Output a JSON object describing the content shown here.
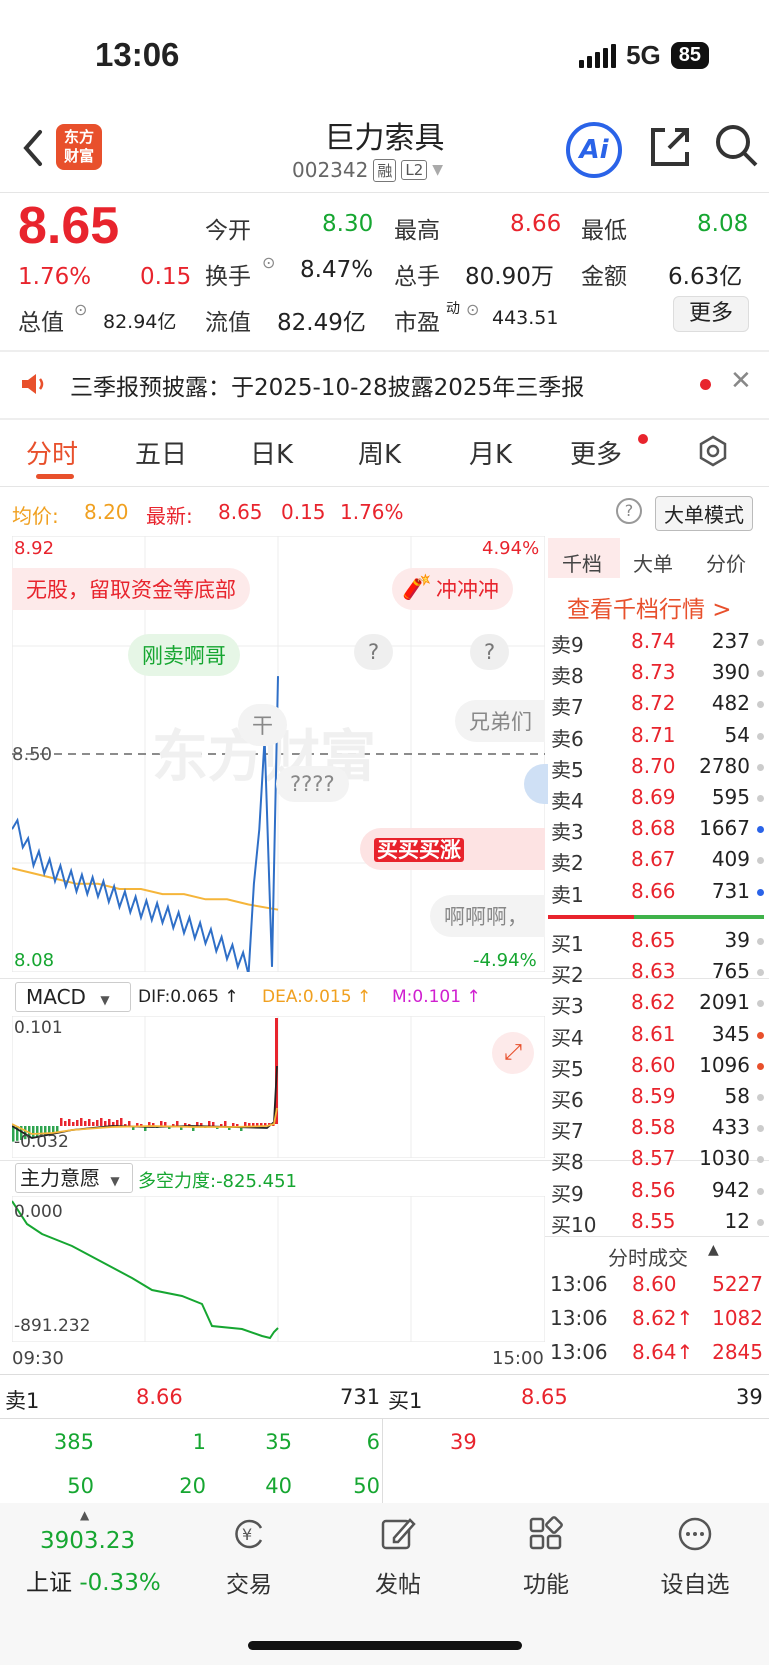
{
  "status": {
    "time": "13:06",
    "network": "5G",
    "battery": "85"
  },
  "header": {
    "logo_line1": "东方",
    "logo_line2": "财富",
    "name": "巨力索具",
    "code": "002342",
    "tag_rong": "融",
    "tag_l2": "L2",
    "ai_label": "Ai"
  },
  "quote": {
    "price": "8.65",
    "change_pct": "1.76%",
    "change": "0.15",
    "open_label": "今开",
    "open": "8.30",
    "high_label": "最高",
    "high": "8.66",
    "low_label": "最低",
    "low": "8.08",
    "turnover_label": "换手",
    "turnover": "8.47%",
    "volume_label": "总手",
    "volume": "80.90万",
    "amount_label": "金额",
    "amount": "6.63亿",
    "mktcap_label": "总值",
    "mktcap": "82.94亿",
    "float_label": "流值",
    "float": "82.49亿",
    "pe_label": "市盈",
    "pe_sup": "动",
    "pe": "443.51",
    "more": "更多"
  },
  "notice": {
    "text": "三季报预披露：于2025-10-28披露2025年三季报"
  },
  "tabs": [
    "分时",
    "五日",
    "日K",
    "周K",
    "月K",
    "更多"
  ],
  "info_row": {
    "avg_label": "均价:",
    "avg": "8.20",
    "latest_label": "最新:",
    "latest": "8.65",
    "chg": "0.15",
    "pct": "1.76%",
    "mode": "大单模式"
  },
  "chart": {
    "y_top": "8.92",
    "pct_top": "4.94%",
    "y_mid": "8.50",
    "y_bot": "8.08",
    "pct_bot": "-4.94%",
    "watermark": "东方财富",
    "bubbles": [
      "无股，留取资金等底部",
      "冲冲冲",
      "刚卖啊哥",
      "?",
      "?",
      "干",
      "兄弟们",
      "????",
      "买买买涨",
      "啊啊啊，"
    ],
    "macd_label": "MACD",
    "dif": "DIF:0.065 ↑",
    "dea": "DEA:0.015 ↑",
    "m": "M:0.101 ↑",
    "macd_top": "0.101",
    "macd_bot": "-0.032",
    "zl_label": "主力意愿",
    "zl_value": "多空力度:-825.451",
    "zl_top": "0.000",
    "zl_bot": "-891.232",
    "t_start": "09:30",
    "t_end": "15:00"
  },
  "chart_data": {
    "type": "line",
    "title": "",
    "ylim": [
      8.08,
      8.92
    ],
    "series": [
      {
        "name": "最新",
        "values": [
          8.37,
          8.3,
          8.27,
          8.25,
          8.24,
          8.22,
          8.2,
          8.19,
          8.17,
          8.15,
          8.12,
          8.09,
          8.65
        ]
      },
      {
        "name": "均价",
        "values": [
          8.28,
          8.27,
          8.26,
          8.25,
          8.25,
          8.24,
          8.24,
          8.23,
          8.23,
          8.22,
          8.22,
          8.21,
          8.2
        ]
      }
    ]
  },
  "orderbook": {
    "tabs": [
      "千档",
      "大单",
      "分价"
    ],
    "link": "查看千档行情 >",
    "sells": [
      {
        "label": "卖9",
        "price": "8.74",
        "vol": "237"
      },
      {
        "label": "卖8",
        "price": "8.73",
        "vol": "390"
      },
      {
        "label": "卖7",
        "price": "8.72",
        "vol": "482"
      },
      {
        "label": "卖6",
        "price": "8.71",
        "vol": "54"
      },
      {
        "label": "卖5",
        "price": "8.70",
        "vol": "2780"
      },
      {
        "label": "卖4",
        "price": "8.69",
        "vol": "595"
      },
      {
        "label": "卖3",
        "price": "8.68",
        "vol": "1667"
      },
      {
        "label": "卖2",
        "price": "8.67",
        "vol": "409"
      },
      {
        "label": "卖1",
        "price": "8.66",
        "vol": "731"
      }
    ],
    "buys": [
      {
        "label": "买1",
        "price": "8.65",
        "vol": "39"
      },
      {
        "label": "买2",
        "price": "8.63",
        "vol": "765"
      },
      {
        "label": "买3",
        "price": "8.62",
        "vol": "2091"
      },
      {
        "label": "买4",
        "price": "8.61",
        "vol": "345"
      },
      {
        "label": "买5",
        "price": "8.60",
        "vol": "1096"
      },
      {
        "label": "买6",
        "price": "8.59",
        "vol": "58"
      },
      {
        "label": "买7",
        "price": "8.58",
        "vol": "433"
      },
      {
        "label": "买8",
        "price": "8.57",
        "vol": "1030"
      },
      {
        "label": "买9",
        "price": "8.56",
        "vol": "942"
      },
      {
        "label": "买10",
        "price": "8.55",
        "vol": "12"
      }
    ],
    "ticks_label": "分时成交",
    "ticks": [
      {
        "t": "13:06",
        "p": "8.60",
        "v": "5227"
      },
      {
        "t": "13:06",
        "p": "8.62↑",
        "v": "1082"
      },
      {
        "t": "13:06",
        "p": "8.64↑",
        "v": "2845"
      }
    ]
  },
  "level1": {
    "sell_label": "卖1",
    "sell_price": "8.66",
    "sell_vol": "731",
    "buy_label": "买1",
    "buy_price": "8.65",
    "buy_vol": "39",
    "sell_queue": [
      "385",
      "1",
      "35",
      "6",
      "50",
      "20",
      "40",
      "50"
    ],
    "buy_queue": [
      "39"
    ]
  },
  "bottom": {
    "index_value": "3903.23",
    "index_name": "上证",
    "index_pct": "-0.33%",
    "tabs": [
      "交易",
      "发帖",
      "功能",
      "设自选"
    ]
  }
}
